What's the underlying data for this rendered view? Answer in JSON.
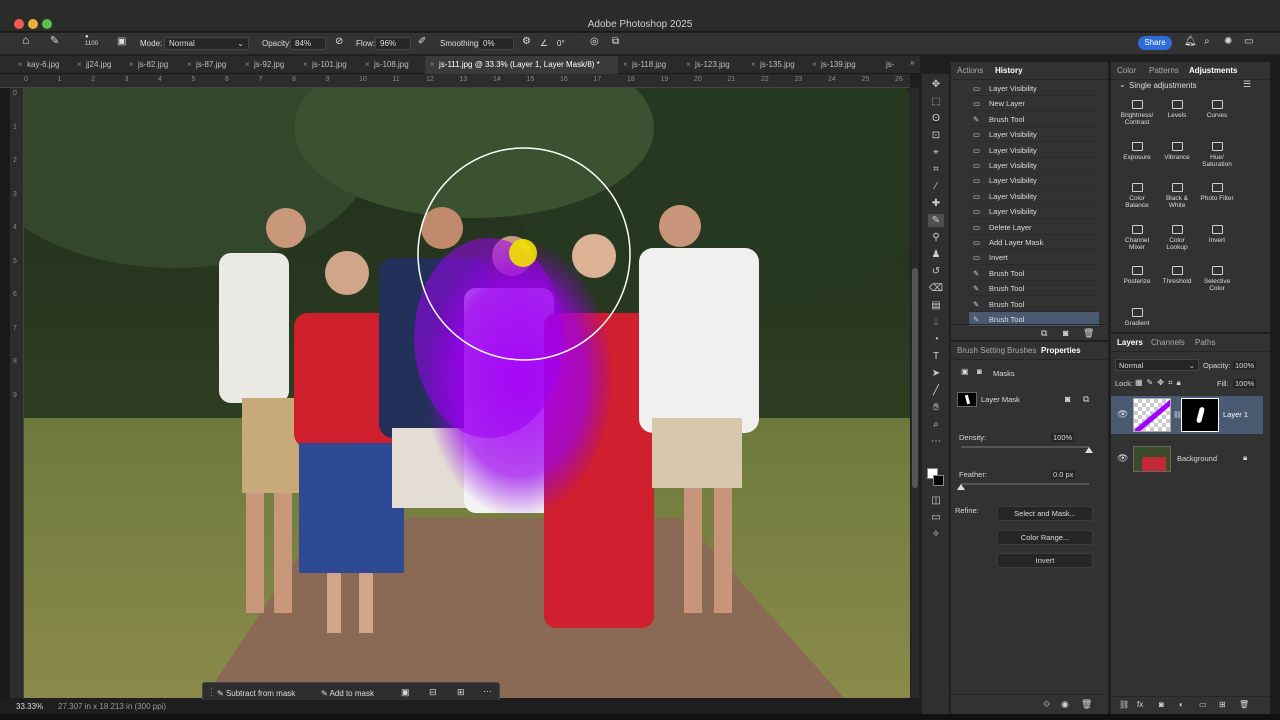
{
  "app": {
    "title": "Adobe Photoshop 2025"
  },
  "options": {
    "brush_size": "1100",
    "mode_label": "Mode:",
    "mode_value": "Normal",
    "opacity_label": "Opacity:",
    "opacity_value": "84%",
    "flow_label": "Flow:",
    "flow_value": "96%",
    "smoothing_label": "Smoothing:",
    "smoothing_value": "0%",
    "angle_value": "0°",
    "share_label": "Share"
  },
  "tabs": [
    "kay-6.jpg",
    "jj24.jpg",
    "js-82.jpg",
    "js-87.jpg",
    "js-92.jpg",
    "js-101.jpg",
    "js-108.jpg",
    "js-111.jpg @ 33.3% (Layer 1, Layer Mask/8) *",
    "js-118.jpg",
    "js-123.jpg",
    "js-135.jpg",
    "js-139.jpg",
    "js-"
  ],
  "ruler": [
    "0",
    "1",
    "2",
    "3",
    "4",
    "5",
    "6",
    "7",
    "8",
    "9",
    "10",
    "11",
    "12",
    "13",
    "14",
    "15",
    "16",
    "17",
    "18",
    "19",
    "20",
    "21",
    "22",
    "23",
    "24",
    "25",
    "26",
    "2"
  ],
  "vruler": [
    "0",
    "1",
    "2",
    "3",
    "4",
    "5",
    "6",
    "7",
    "8",
    "9"
  ],
  "status": {
    "zoom": "33.33%",
    "size": "27.307 in x 18.213 in (300 ppi)"
  },
  "context_bar": {
    "subtract": "Subtract from mask",
    "add": "Add to mask"
  },
  "history": {
    "tabs": [
      "Actions",
      "History"
    ],
    "items": [
      {
        "label": "Layer Visibility",
        "icon": "eye-icon"
      },
      {
        "label": "New Layer",
        "icon": "layer-icon"
      },
      {
        "label": "Brush Tool",
        "icon": "brush-icon"
      },
      {
        "label": "Layer Visibility",
        "icon": "eye-icon"
      },
      {
        "label": "Layer Visibility",
        "icon": "eye-icon"
      },
      {
        "label": "Layer Visibility",
        "icon": "eye-icon"
      },
      {
        "label": "Layer Visibility",
        "icon": "eye-icon"
      },
      {
        "label": "Layer Visibility",
        "icon": "eye-icon"
      },
      {
        "label": "Layer Visibility",
        "icon": "eye-icon"
      },
      {
        "label": "Delete Layer",
        "icon": "layer-icon"
      },
      {
        "label": "Add Layer Mask",
        "icon": "layer-icon"
      },
      {
        "label": "Invert",
        "icon": "layer-icon"
      },
      {
        "label": "Brush Tool",
        "icon": "brush-icon"
      },
      {
        "label": "Brush Tool",
        "icon": "brush-icon"
      },
      {
        "label": "Brush Tool",
        "icon": "brush-icon"
      },
      {
        "label": "Brush Tool",
        "icon": "brush-icon"
      }
    ]
  },
  "properties": {
    "tabs": [
      "Brush Setting",
      "Brushes",
      "Properties"
    ],
    "section": "Masks",
    "layer_mask_label": "Layer Mask",
    "density_label": "Density:",
    "density_value": "100%",
    "density_level": 1.0,
    "feather_label": "Feather:",
    "feather_value": "0.0 px",
    "feather_level": 0.0,
    "refine_label": "Refine:",
    "buttons": [
      "Select and Mask...",
      "Color Range...",
      "Invert"
    ]
  },
  "adjustments": {
    "tabs": [
      "Color",
      "Patterns",
      "Adjustments"
    ],
    "section": "Single adjustments",
    "items": [
      [
        "Brightness/",
        "Contrast"
      ],
      [
        "Levels"
      ],
      [
        "Curves"
      ],
      [
        "Exposure"
      ],
      [
        "Vibrance"
      ],
      [
        "Hue/",
        "Saturation"
      ],
      [
        "Color",
        "Balance"
      ],
      [
        "Black &",
        "White"
      ],
      [
        "Photo Filter"
      ],
      [
        "Channel",
        "Mixer"
      ],
      [
        "Color",
        "Lookup"
      ],
      [
        "Invert"
      ],
      [
        "Posterize"
      ],
      [
        "Threshold"
      ],
      [
        "Selective",
        "Color"
      ],
      [
        "Gradient"
      ]
    ]
  },
  "layers": {
    "tabs": [
      "Layers",
      "Channels",
      "Paths"
    ],
    "blend_mode": "Normal",
    "opacity_label": "Opacity:",
    "opacity_value": "100%",
    "lock_label": "Lock:",
    "fill_label": "Fill:",
    "fill_value": "100%",
    "items": [
      {
        "name": "Layer 1"
      },
      {
        "name": "Background"
      }
    ]
  },
  "colors": {
    "accent": "#2f6bd9",
    "mask_overlay": "#a100ff",
    "cursor_dot": "#f2e200",
    "dress_red": "#d01f2e",
    "selection": "#4a5a72"
  }
}
